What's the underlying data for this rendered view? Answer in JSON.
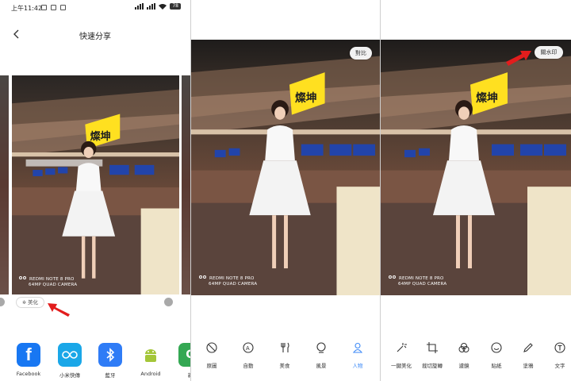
{
  "panel1": {
    "status": {
      "time": "上午11:42",
      "battery": "78"
    },
    "title": "快速分享",
    "watermark": {
      "line1": "REDMI NOTE 8 PRO",
      "line2": "64MP QUAD CAMERA"
    },
    "sign_text": "燦坤",
    "beautify_label": "美化",
    "share_targets": [
      {
        "label": "Facebook"
      },
      {
        "label": "小米快傳"
      },
      {
        "label": "藍牙"
      },
      {
        "label": "Android"
      },
      {
        "label": "新"
      }
    ]
  },
  "panel2": {
    "compare_label": "對比",
    "watermark": {
      "line1": "REDMI NOTE 8 PRO",
      "line2": "64MP QUAD CAMERA"
    },
    "sign_text": "燦坤",
    "tools": [
      {
        "label": "原圖"
      },
      {
        "label": "自動"
      },
      {
        "label": "美食"
      },
      {
        "label": "風景"
      },
      {
        "label": "人物"
      }
    ],
    "active_tool": "人物"
  },
  "panel3": {
    "watermark_toggle_label": "關水印",
    "watermark": {
      "line1": "REDMI NOTE 8 PRO",
      "line2": "64MP QUAD CAMERA"
    },
    "sign_text": "燦坤",
    "tools": [
      {
        "label": "一鍵美化"
      },
      {
        "label": "裁切旋轉"
      },
      {
        "label": "濾鏡"
      },
      {
        "label": "貼紙"
      },
      {
        "label": "塗鴉"
      },
      {
        "label": "文字"
      }
    ]
  },
  "colors": {
    "accent_blue": "#3d8af7",
    "arrow_red": "#e21d1d",
    "facebook": "#1877f2",
    "mi_share": "#1aa7e8",
    "bluetooth": "#2f7cf6",
    "android": "#a4c639"
  }
}
